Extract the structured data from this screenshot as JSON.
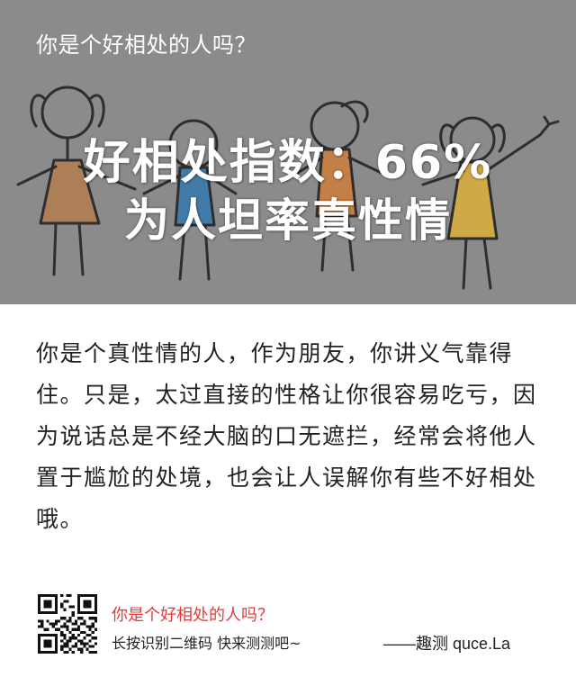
{
  "banner": {
    "quiz_title": "你是个好相处的人吗？",
    "headline_1": "好相处指数：66%",
    "headline_2": "为人坦率真性情",
    "colors": {
      "background": "#8b8b8b",
      "dress_orange": "#c27a3e",
      "dress_blue": "#1f76b8",
      "dress_yellow": "#e9b52b"
    }
  },
  "result": {
    "description": "你是个真性情的人，作为朋友，你讲义气靠得住。只是，太过直接的性格让你很容易吃亏，因为说话总是不经大脑的口无遮拦，经常会将他人置于尴尬的处境，也会让人误解你有些不好相处哦。"
  },
  "footer": {
    "promo_title": "你是个好相处的人吗？",
    "promo_sub": "长按识别二维码  快来测测吧~",
    "credit": "——趣测 quce.La",
    "qr_icon": "qr-code-icon"
  }
}
